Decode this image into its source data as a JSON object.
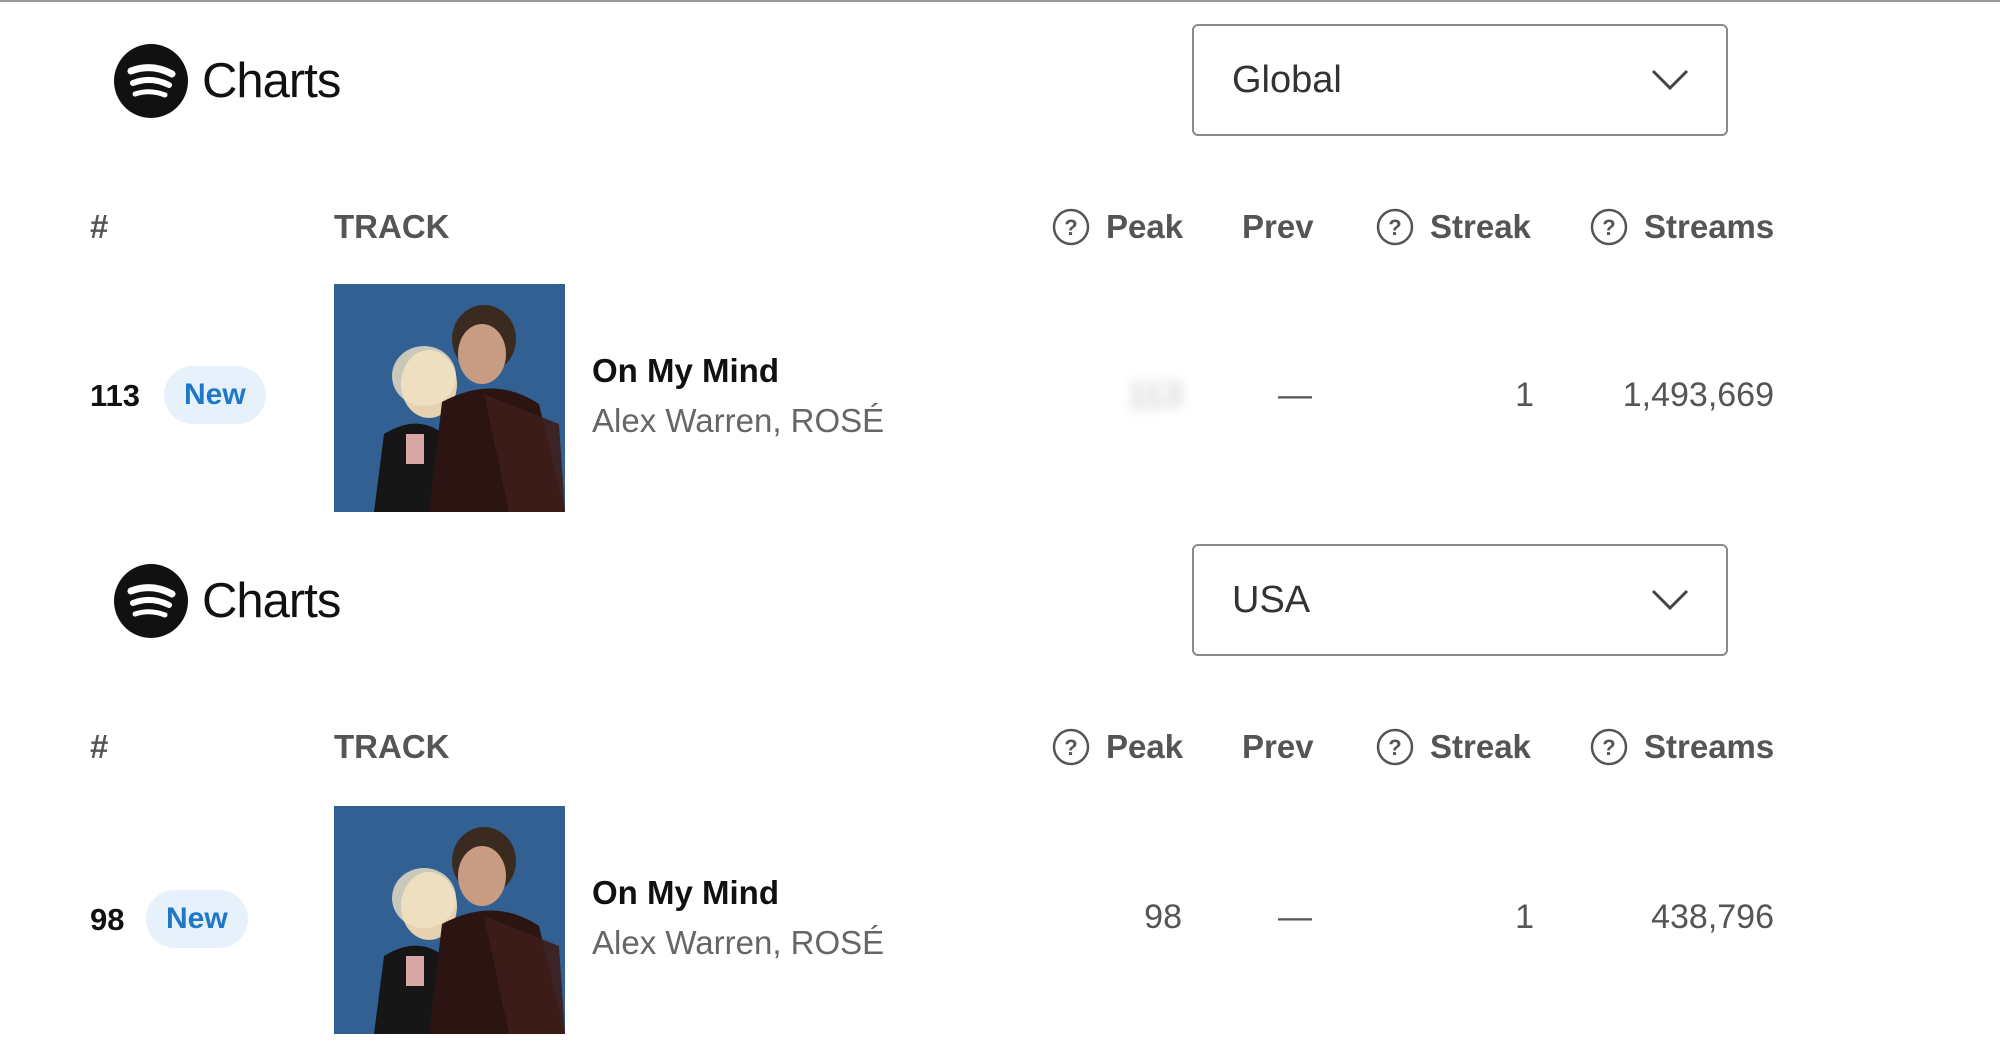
{
  "sections": [
    {
      "brand": "Charts",
      "region": "Global",
      "headers": {
        "rank": "#",
        "track": "TRACK",
        "peak": "Peak",
        "prev": "Prev",
        "streak": "Streak",
        "streams": "Streams"
      },
      "row": {
        "rank": "113",
        "badge": "New",
        "title": "On My Mind",
        "artist": "Alex Warren, ROSÉ",
        "peak": "113",
        "prev": "—",
        "streak": "1",
        "streams": "1,493,669"
      }
    },
    {
      "brand": "Charts",
      "region": "USA",
      "headers": {
        "rank": "#",
        "track": "TRACK",
        "peak": "Peak",
        "prev": "Prev",
        "streak": "Streak",
        "streams": "Streams"
      },
      "row": {
        "rank": "98",
        "badge": "New",
        "title": "On My Mind",
        "artist": "Alex Warren, ROSÉ",
        "peak": "98",
        "prev": "—",
        "streak": "1",
        "streams": "438,796"
      }
    }
  ],
  "icons": {
    "logo": "spotify-logo-icon",
    "dropdown": "chevron-down-icon",
    "info": "question-circle-icon"
  },
  "colors": {
    "badge_bg": "#e6f1fb",
    "badge_text": "#1f78c7",
    "cover_bg": "#2d5a8a"
  }
}
